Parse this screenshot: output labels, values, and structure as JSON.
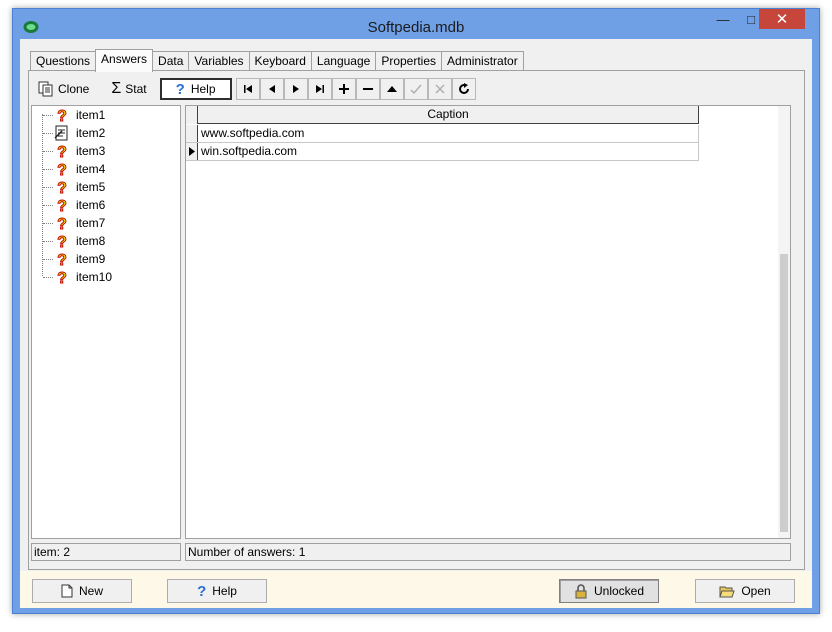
{
  "window": {
    "title": "Softpedia.mdb",
    "min_glyph": "—",
    "max_glyph": "□",
    "close_glyph": "✕"
  },
  "tabs": [
    {
      "label": "Questions"
    },
    {
      "label": "Answers",
      "active": true
    },
    {
      "label": "Data"
    },
    {
      "label": "Variables"
    },
    {
      "label": "Keyboard"
    },
    {
      "label": "Language"
    },
    {
      "label": "Properties"
    },
    {
      "label": "Administrator"
    }
  ],
  "toolbar": {
    "clone_label": "Clone",
    "stat_label": "Stat",
    "help_label": "Help",
    "nav_buttons": [
      "first-record-icon",
      "prior-record-icon",
      "next-record-icon",
      "last-record-icon",
      "insert-record-icon",
      "delete-record-icon",
      "move-up-icon",
      "post-edit-icon",
      "cancel-edit-icon",
      "refresh-icon"
    ]
  },
  "tree": {
    "items": [
      {
        "label": "item1",
        "icon": "question-icon"
      },
      {
        "label": "item2",
        "icon": "edit-document-icon",
        "selected": true
      },
      {
        "label": "item3",
        "icon": "question-icon"
      },
      {
        "label": "item4",
        "icon": "question-icon"
      },
      {
        "label": "item5",
        "icon": "question-icon"
      },
      {
        "label": "item6",
        "icon": "question-icon"
      },
      {
        "label": "item7",
        "icon": "question-icon"
      },
      {
        "label": "item8",
        "icon": "question-icon"
      },
      {
        "label": "item9",
        "icon": "question-icon"
      },
      {
        "label": "item10",
        "icon": "question-icon"
      }
    ]
  },
  "grid": {
    "columns": [
      "Caption"
    ],
    "rows": [
      {
        "caption": "www.softpedia.com",
        "current": false
      },
      {
        "caption": "win.softpedia.com",
        "current": true
      }
    ]
  },
  "status": {
    "left": "item: 2",
    "right": "Number of answers: 1"
  },
  "bottom": {
    "new_label": "New",
    "help_label": "Help",
    "lock_label": "Unlocked",
    "open_label": "Open"
  },
  "colors": {
    "title_bar": "#6fa0e6",
    "close_button": "#c7463b",
    "bottom_bar": "#fdf8e8"
  }
}
